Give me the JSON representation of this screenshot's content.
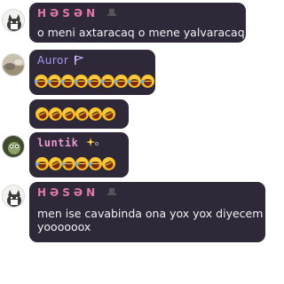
{
  "messages": [
    {
      "id": "m1",
      "author": "HƏSƏN",
      "author_badge": "🎩",
      "text_lines": [
        "o meni axtaracaq o mene yalvaracaq"
      ],
      "avatar": "cat-avatar"
    },
    {
      "id": "m2",
      "author": "Auror",
      "author_badge": "🏳",
      "emoji_rows": [
        {
          "emoji": "face-with-tears-of-joy",
          "count": 9
        }
      ],
      "avatar": "landscape-avatar"
    },
    {
      "id": "m3",
      "emoji_rows": [
        {
          "emoji": "rolling-on-the-floor-laughing",
          "count": 6
        }
      ]
    },
    {
      "id": "m4",
      "author": "luntik",
      "author_badge": "✨",
      "emoji_rows": [
        {
          "emoji": "mixed-laughing",
          "count": 6
        }
      ],
      "avatar": "character-avatar"
    },
    {
      "id": "m5",
      "author": "HƏSƏN",
      "author_badge": "🎩",
      "text_lines": [
        "men ise cavabinda ona yox yox diyecem",
        "yoooooox"
      ],
      "avatar": "cat-avatar"
    }
  ],
  "colors": {
    "bubble_bg": "#2e2838",
    "name_hasan": "#e07aa6",
    "name_auror": "#a89cf2",
    "name_luntik": "#e79bd3",
    "text": "#f4f2f7"
  }
}
